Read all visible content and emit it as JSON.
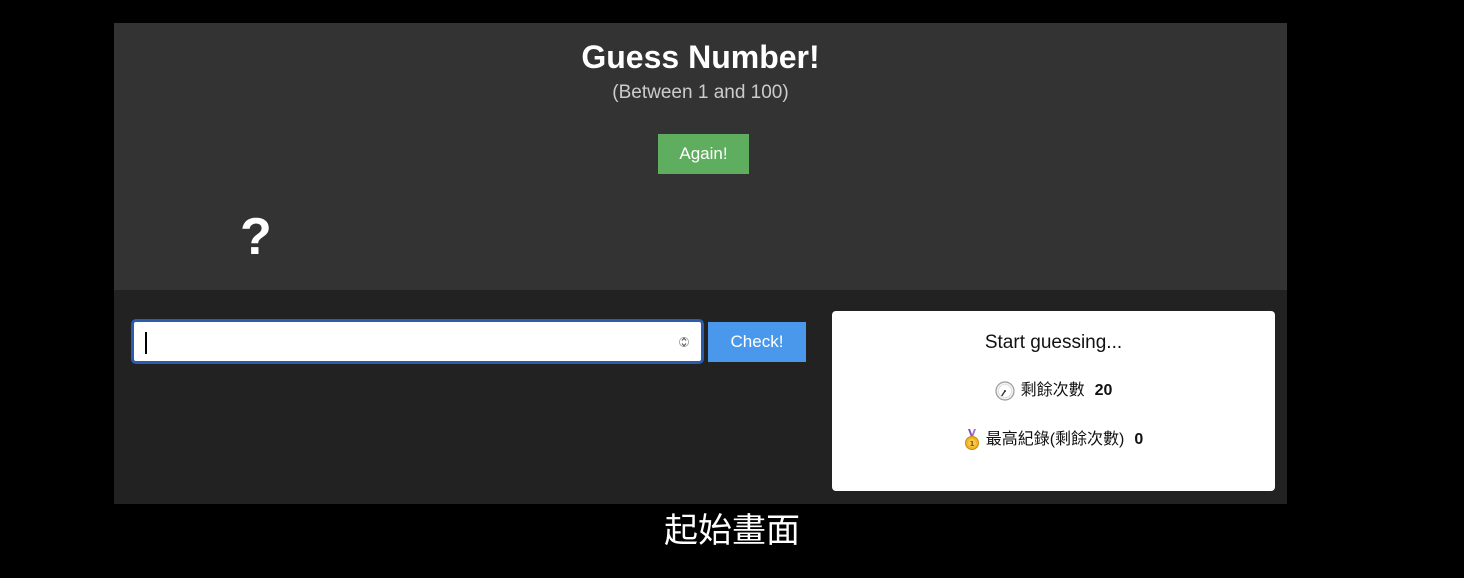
{
  "header": {
    "title": "Guess Number!",
    "subtitle": "(Between 1 and 100)",
    "again_label": "Again!",
    "secret_number": "?"
  },
  "guess": {
    "input_value": "",
    "check_label": "Check!"
  },
  "status": {
    "message": "Start guessing...",
    "remaining_label": "剩餘次數",
    "remaining_icon": "stopwatch-icon",
    "remaining_value": "20",
    "best_label": "最高紀錄(剩餘次數)",
    "best_icon": "medal-icon",
    "best_value": "0"
  },
  "caption": "起始畫面",
  "colors": {
    "again_button": "#5fae5f",
    "check_button": "#4a98ec",
    "top_panel": "#333333",
    "bottom_panel": "#222222"
  }
}
